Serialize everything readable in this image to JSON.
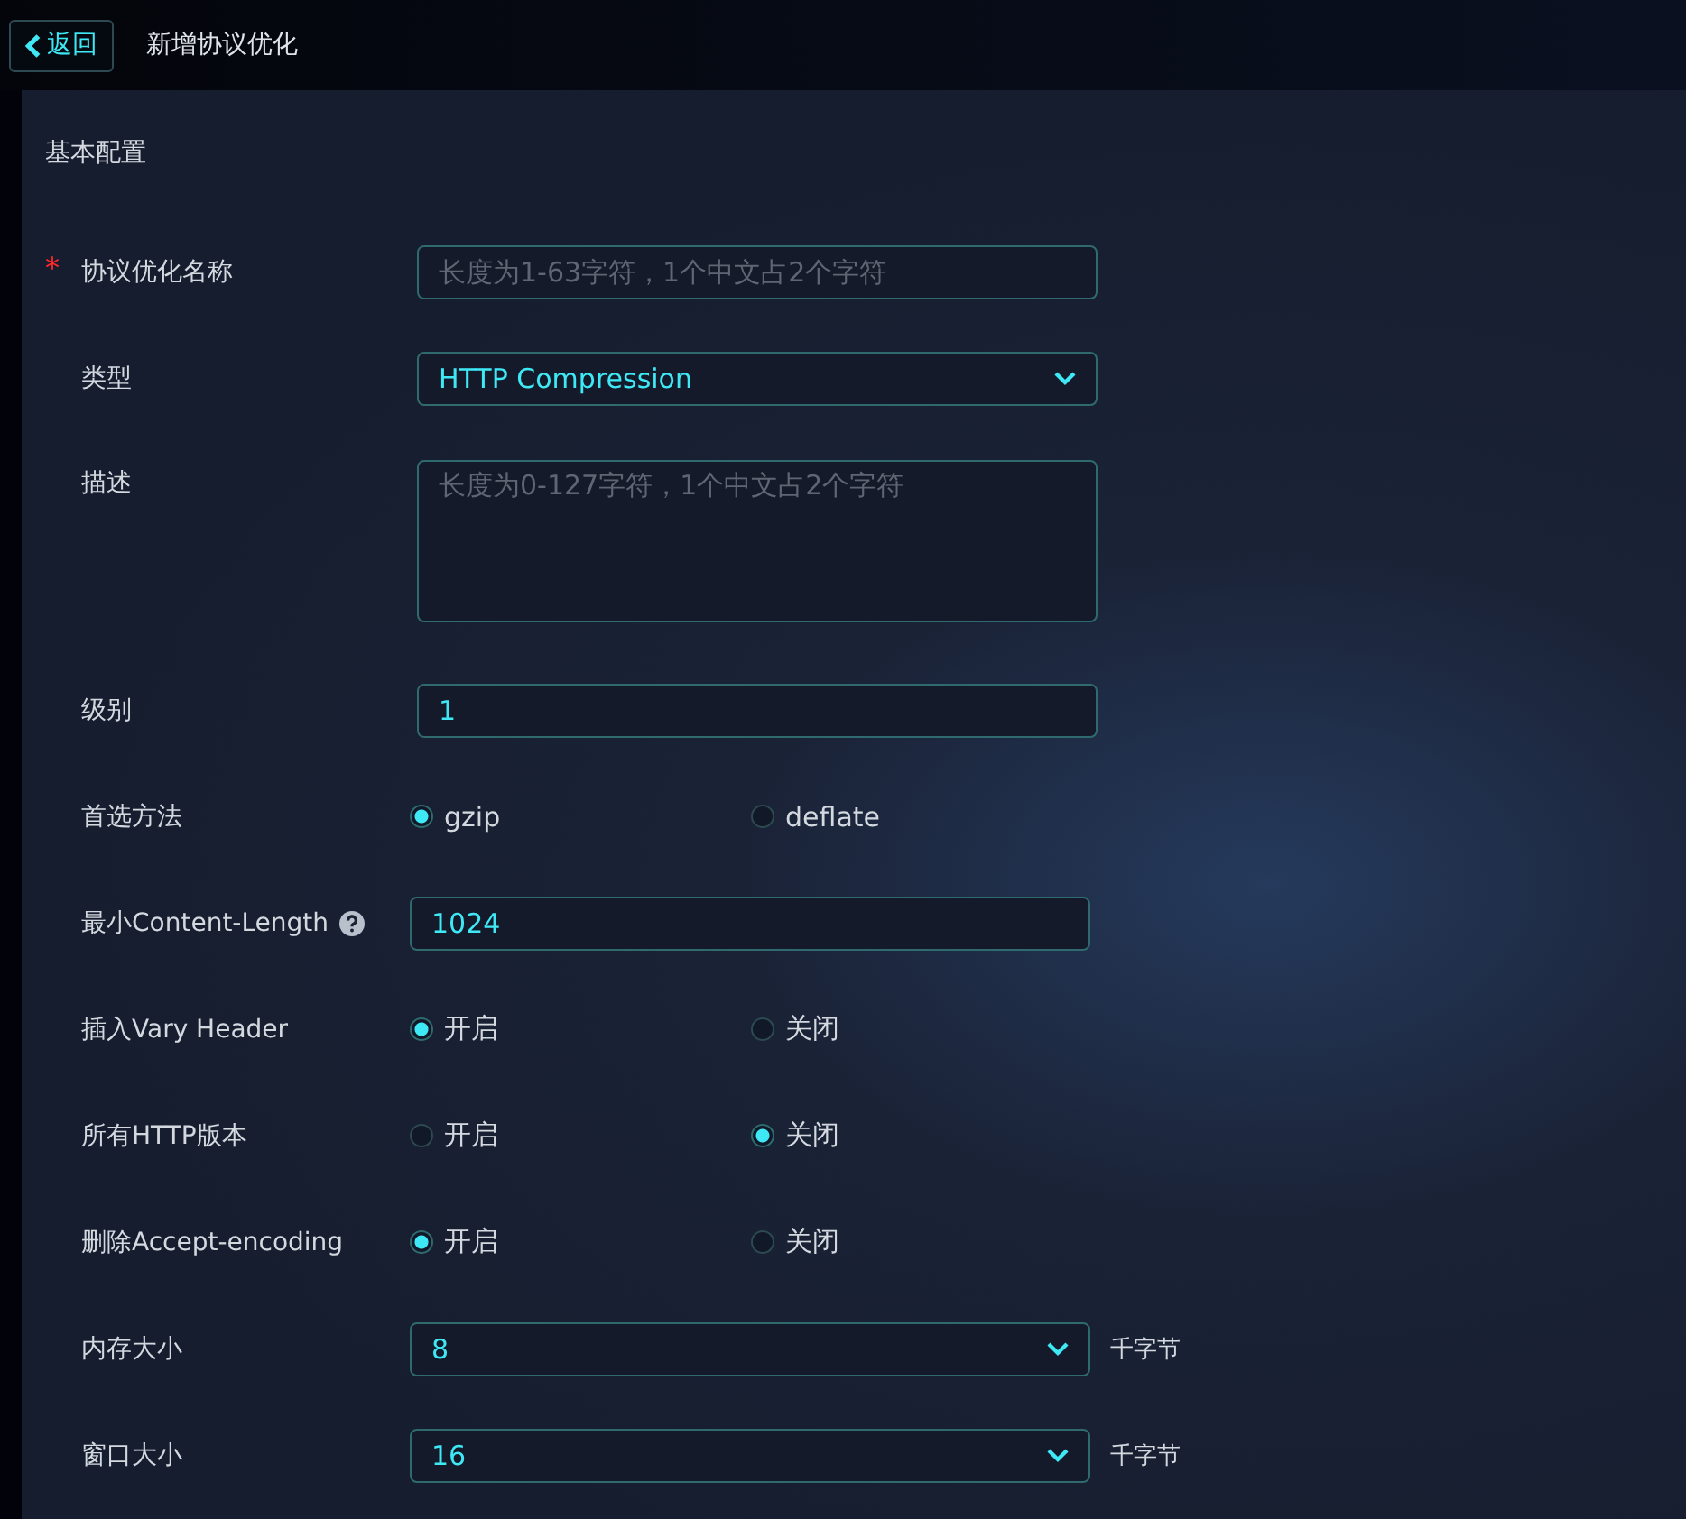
{
  "header": {
    "back_button": "返回",
    "title": "新增协议优化"
  },
  "section_title": "基本配置",
  "fields": [
    {
      "kind": "text",
      "label": "协议优化名称",
      "required_mark": "*",
      "placeholder": "长度为1-63字符，1个中文占2个字符"
    },
    {
      "kind": "select",
      "label": "类型",
      "value": "HTTP Compression"
    },
    {
      "kind": "textarea",
      "label": "描述",
      "placeholder": "长度为0-127字符，1个中文占2个字符"
    },
    {
      "kind": "text",
      "label": "级别",
      "value": "1"
    },
    {
      "kind": "radio",
      "label": "首选方法",
      "options": [
        {
          "label": "gzip",
          "selected": true
        },
        {
          "label": "deflate",
          "selected": false
        }
      ]
    },
    {
      "kind": "text",
      "label": "最小Content-Length",
      "help": true,
      "value": "1024"
    },
    {
      "kind": "radio",
      "label": "插入Vary Header",
      "options": [
        {
          "label": "开启",
          "selected": true
        },
        {
          "label": "关闭",
          "selected": false
        }
      ]
    },
    {
      "kind": "radio",
      "label": "所有HTTP版本",
      "options": [
        {
          "label": "开启",
          "selected": false
        },
        {
          "label": "关闭",
          "selected": true
        }
      ]
    },
    {
      "kind": "radio",
      "label": "删除Accept-encoding",
      "options": [
        {
          "label": "开启",
          "selected": true
        },
        {
          "label": "关闭",
          "selected": false
        }
      ]
    },
    {
      "kind": "select",
      "label": "内存大小",
      "value": "8",
      "unit": "千字节"
    },
    {
      "kind": "select",
      "label": "窗口大小",
      "value": "16",
      "unit": "千字节"
    }
  ]
}
